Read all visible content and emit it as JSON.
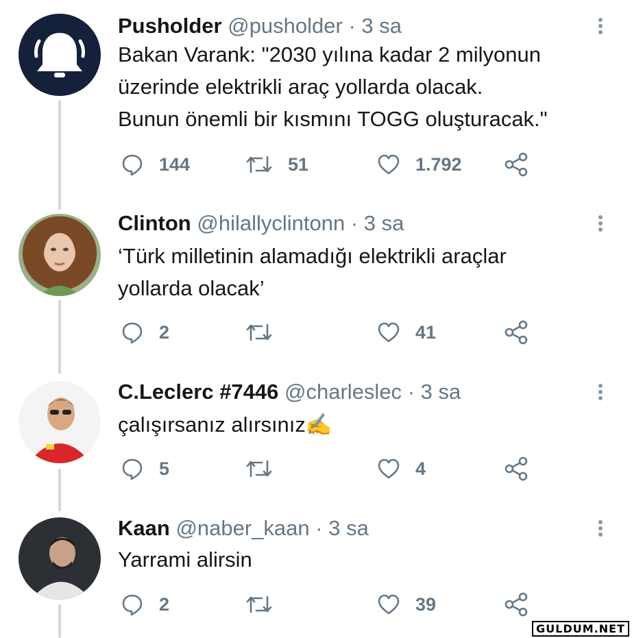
{
  "tweets": [
    {
      "name": "Pusholder",
      "handle": "@pusholder",
      "time": "· 3 sa",
      "lines": [
        "Bakan Varank: \"2030 yılına kadar 2 milyonun",
        "üzerinde elektrikli araç yollarda olacak.",
        "Bunun önemli bir kısmını TOGG oluşturacak.\""
      ],
      "replies": "144",
      "retweets": "51",
      "likes": "1.792",
      "avatar_icon": "bell-icon"
    },
    {
      "name": "Clinton",
      "handle": "@hilallyclintonn",
      "time": "· 3 sa",
      "lines": [
        "‘Türk milletinin alamadığı elektrikli araçlar",
        "yollarda olacak’"
      ],
      "replies": "2",
      "retweets": "",
      "likes": "41"
    },
    {
      "name": "C.Leclerc #7446",
      "handle": "@charleslec",
      "time": "· 3 sa",
      "lines": [
        "çalışırsanız alırsınız✍️"
      ],
      "replies": "5",
      "retweets": "",
      "likes": "4"
    },
    {
      "name": "Kaan",
      "handle": "@naber_kaan",
      "time": "· 3 sa",
      "lines": [
        "Yarrami alirsin"
      ],
      "replies": "2",
      "retweets": "",
      "likes": "39"
    }
  ],
  "colors": {
    "muted": "#657786",
    "text": "#14171a",
    "bell_bg": "#15203b"
  },
  "watermark": "GULDUM.NET"
}
